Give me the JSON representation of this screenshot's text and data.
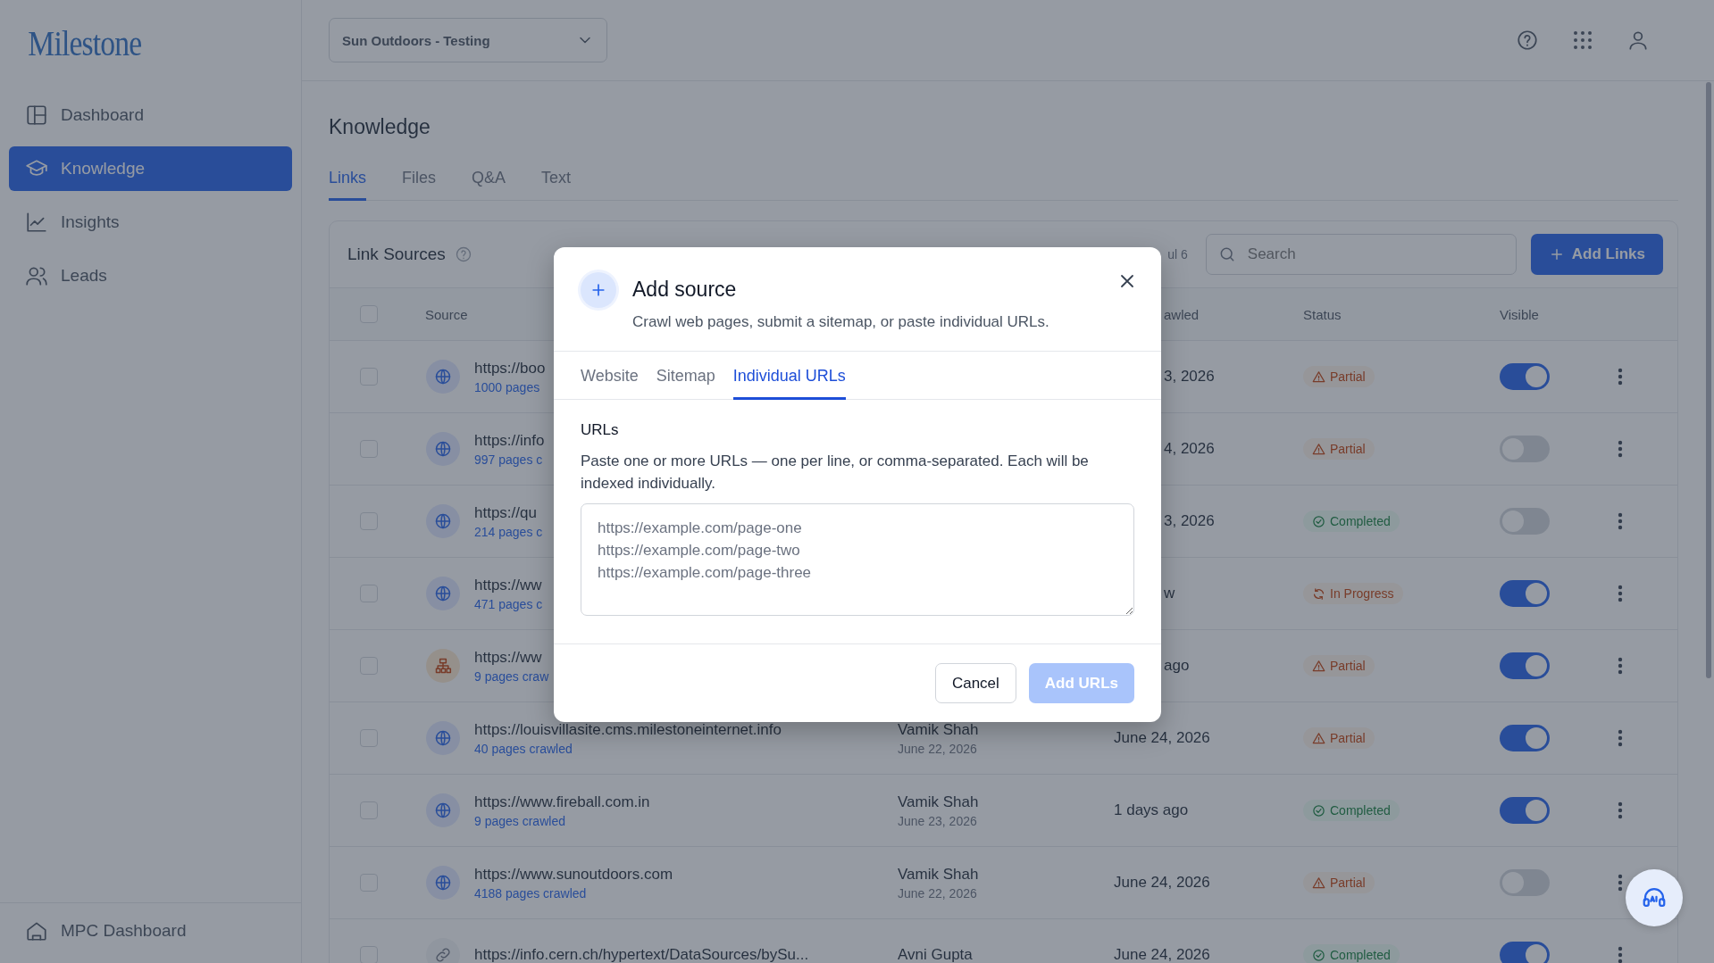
{
  "sidebar": {
    "logo": "Milestone",
    "items": [
      {
        "label": "Dashboard",
        "selected": false
      },
      {
        "label": "Knowledge",
        "selected": true
      },
      {
        "label": "Insights",
        "selected": false
      },
      {
        "label": "Leads",
        "selected": false
      }
    ],
    "footer_item": {
      "label": "MPC Dashboard"
    }
  },
  "header": {
    "workspace": "Sun Outdoors - Testing"
  },
  "page": {
    "title": "Knowledge",
    "tabs": [
      {
        "label": "Links",
        "selected": true
      },
      {
        "label": "Files",
        "selected": false
      },
      {
        "label": "Q&A",
        "selected": false
      },
      {
        "label": "Text",
        "selected": false
      }
    ]
  },
  "card": {
    "title": "Link Sources",
    "filter_fragment": "ul 6",
    "search": {
      "placeholder": "Search"
    },
    "add_button": "Add Links",
    "select_all_checked": false,
    "columns": [
      {
        "label": "Source"
      },
      {
        "label": "awled",
        "covered": true
      },
      {
        "label": "Status"
      },
      {
        "label": "Visible"
      }
    ],
    "rows": [
      {
        "checked": false,
        "kind": "globe",
        "url": "https://boo",
        "pages": "1000 pages",
        "crawled": "3, 2026",
        "covered": true,
        "status": {
          "kind": "partial",
          "label": "Partial"
        },
        "visible": true
      },
      {
        "checked": false,
        "kind": "globe",
        "url": "https://info",
        "pages": "997 pages c",
        "crawled": "4, 2026",
        "covered": true,
        "status": {
          "kind": "partial",
          "label": "Partial"
        },
        "visible": false
      },
      {
        "checked": false,
        "kind": "globe",
        "url": "https://qu",
        "pages": "214 pages c",
        "crawled": "3, 2026",
        "covered": true,
        "status": {
          "kind": "completed",
          "label": "Completed"
        },
        "visible": false
      },
      {
        "checked": false,
        "kind": "globe",
        "url": "https://ww",
        "pages": "471 pages c",
        "crawled": "w",
        "covered": true,
        "status": {
          "kind": "in_progress",
          "label": "In Progress"
        },
        "visible": true
      },
      {
        "checked": false,
        "kind": "sitemap",
        "url": "https://ww",
        "pages": "9 pages craw",
        "crawled": "ago",
        "covered": true,
        "status": {
          "kind": "partial",
          "label": "Partial"
        },
        "visible": true
      },
      {
        "checked": false,
        "kind": "globe",
        "url": "https://louisvillasite.cms.milestoneinternet.info",
        "pages": "40 pages crawled",
        "added_by": "Vamik Shah",
        "added_on": "June 22, 2026",
        "crawled": "June 24, 2026",
        "covered": false,
        "status": {
          "kind": "partial",
          "label": "Partial"
        },
        "visible": true
      },
      {
        "checked": false,
        "kind": "globe",
        "url": "https://www.fireball.com.in",
        "pages": "9 pages crawled",
        "added_by": "Vamik Shah",
        "added_on": "June 23, 2026",
        "crawled": "1 days ago",
        "covered": false,
        "status": {
          "kind": "completed",
          "label": "Completed"
        },
        "visible": true
      },
      {
        "checked": false,
        "kind": "globe",
        "url": "https://www.sunoutdoors.com",
        "pages": "4188 pages crawled",
        "added_by": "Vamik Shah",
        "added_on": "June 22, 2026",
        "crawled": "June 24, 2026",
        "covered": false,
        "status": {
          "kind": "partial",
          "label": "Partial"
        },
        "visible": false
      },
      {
        "checked": false,
        "kind": "link",
        "url": "https://info.cern.ch/hypertext/DataSources/bySu...",
        "added_by": "Avni Gupta",
        "crawled": "June 24, 2026",
        "covered": false,
        "status": {
          "kind": "completed",
          "label": "Completed"
        },
        "visible": true
      }
    ]
  },
  "modal": {
    "title": "Add source",
    "subtitle": "Crawl web pages, submit a sitemap, or paste individual URLs.",
    "tabs": [
      {
        "label": "Website",
        "selected": false
      },
      {
        "label": "Sitemap",
        "selected": false
      },
      {
        "label": "Individual URLs",
        "selected": true
      }
    ],
    "field_label": "URLs",
    "help": "Paste one or more URLs — one per line, or comma-separated. Each will be indexed individually.",
    "placeholder": "https://example.com/page-one\nhttps://example.com/page-two\nhttps://example.com/page-three",
    "buttons": [
      {
        "label": "Cancel",
        "kind": "secondary"
      },
      {
        "label": "Add URLs",
        "kind": "primary",
        "disabled": true
      }
    ]
  }
}
